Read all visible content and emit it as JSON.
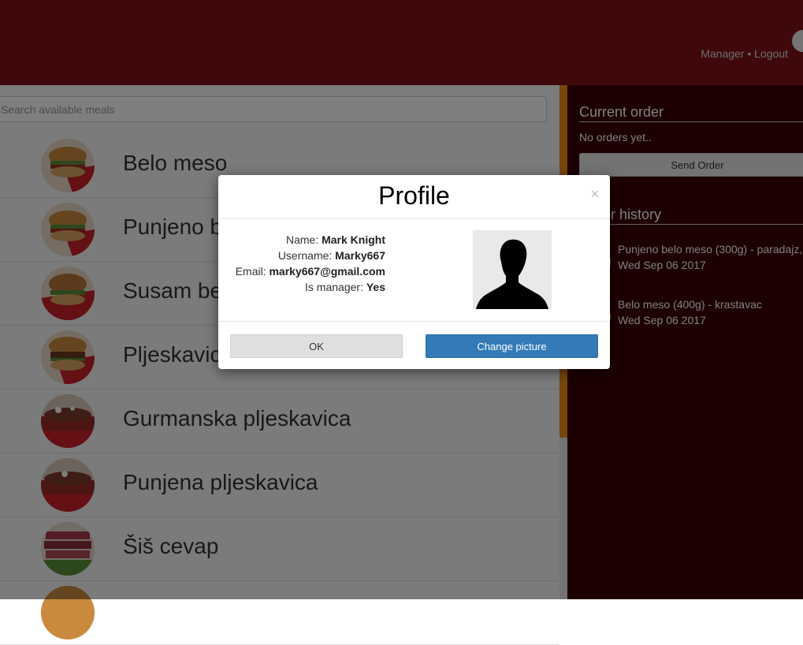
{
  "header": {
    "manager_label": "Manager",
    "separator": "•",
    "logout_label": "Logout"
  },
  "search": {
    "placeholder": "Search available meals"
  },
  "meals": [
    {
      "name": "Belo meso"
    },
    {
      "name": "Punjeno belo meso"
    },
    {
      "name": "Susam belo meso"
    },
    {
      "name": "Pljeskavica"
    },
    {
      "name": "Gurmanska pljeskavica"
    },
    {
      "name": "Punjena pljeskavica"
    },
    {
      "name": "Šiš cevap"
    }
  ],
  "current_order": {
    "title": "Current order",
    "empty_text": "No orders yet..",
    "send_button": "Send Order"
  },
  "order_history": {
    "title": "Order history",
    "items": [
      {
        "line1": "Punjeno belo meso (300g) - paradajz,",
        "line2": "Wed Sep 06 2017"
      },
      {
        "line1": "Belo meso (400g) - krastavac",
        "line2": "Wed Sep 06 2017"
      }
    ]
  },
  "modal": {
    "title": "Profile",
    "close": "×",
    "fields": [
      {
        "label": "Name:",
        "value": "Mark Knight"
      },
      {
        "label": "Username:",
        "value": "Marky667"
      },
      {
        "label": "Email:",
        "value": "marky667@gmail.com"
      },
      {
        "label": "Is manager:",
        "value": "Yes"
      }
    ],
    "ok_button": "OK",
    "change_picture_button": "Change picture"
  },
  "colors": {
    "header_bg": "#7e1316",
    "right_panel_bg": "#3a0004",
    "primary_button": "#337ab7",
    "scroll_accent": "#f08a1a"
  }
}
